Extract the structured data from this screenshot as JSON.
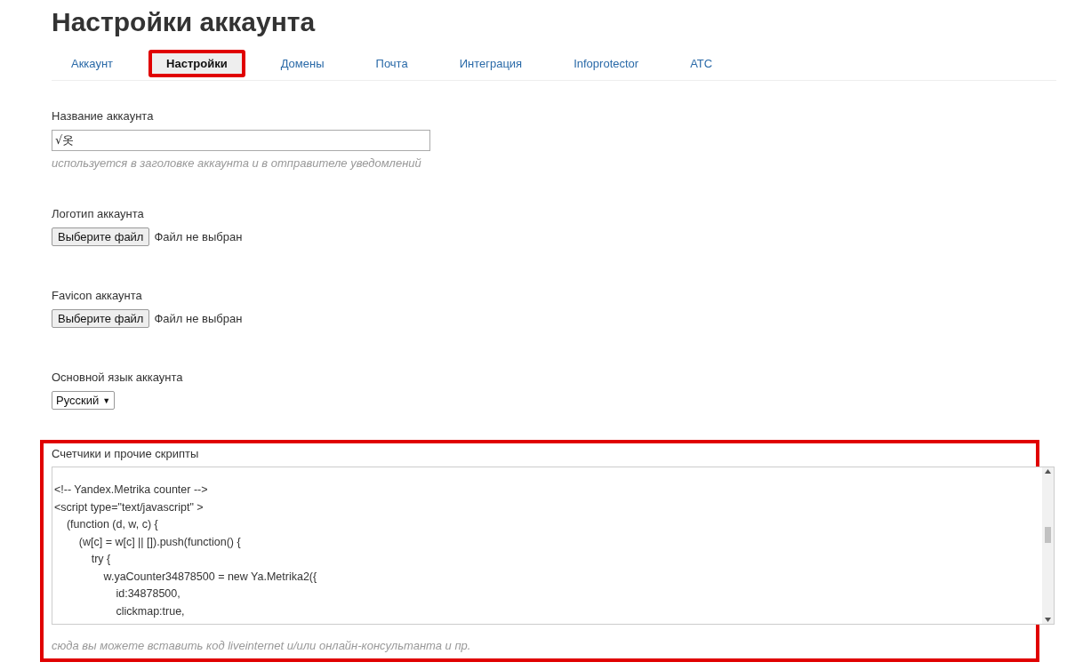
{
  "page": {
    "title": "Настройки аккаунта"
  },
  "tabs": [
    {
      "label": "Аккаунт",
      "selected": false
    },
    {
      "label": "Настройки",
      "selected": true
    },
    {
      "label": "Домены",
      "selected": false
    },
    {
      "label": "Почта",
      "selected": false
    },
    {
      "label": "Интеграция",
      "selected": false
    },
    {
      "label": "Infoprotector",
      "selected": false
    },
    {
      "label": "АТС",
      "selected": false
    }
  ],
  "fields": [
    {
      "kind": "text",
      "label": "Название аккаунта",
      "value": "√옷",
      "hint": "используется в заголовке аккаунта и в отправителе уведомлений"
    },
    {
      "kind": "file",
      "label": "Логотип аккаунта",
      "button": "Выберите файл",
      "status": "Файл не выбран"
    },
    {
      "kind": "file",
      "label": "Favicon аккаунта",
      "button": "Выберите файл",
      "status": "Файл не выбран"
    },
    {
      "kind": "select",
      "label": "Основной язык аккаунта",
      "value": "Русский",
      "arrow": "▼"
    }
  ],
  "scripts": {
    "label": "Счетчики и прочие скрипты",
    "code_lines": [
      "<!-- Yandex.Metrika counter -->",
      "<script type=\"text/javascript\" >",
      "    (function (d, w, c) {",
      "        (w[c] = w[c] || []).push(function() {",
      "            try {",
      "                w.yaCounter34878500 = new Ya.Metrika2({",
      "                    id:34878500,",
      "                    clickmap:true,"
    ],
    "hint": "сюда вы можете вставить код liveinternet и/или онлайн-консультанта и пр."
  }
}
